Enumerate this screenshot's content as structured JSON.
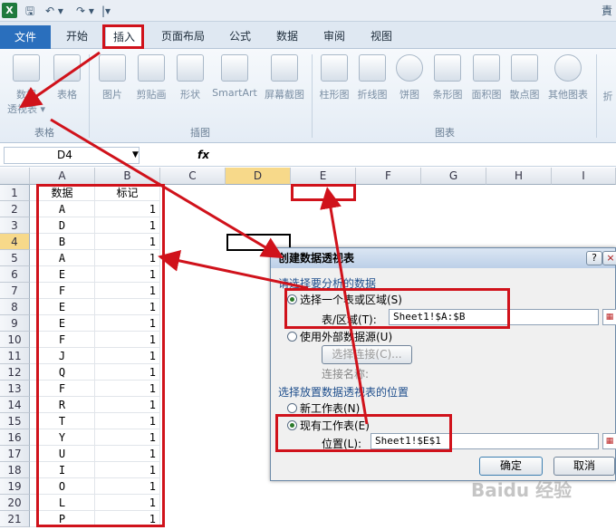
{
  "qat": {
    "logo": "X",
    "save": "🖫",
    "undo": "↶ ▾",
    "redo": "↷ ▾",
    "customize": "|▾",
    "right_edge": "責"
  },
  "tabs": [
    "文件",
    "开始",
    "插入",
    "页面布局",
    "公式",
    "数据",
    "审阅",
    "视图"
  ],
  "ribbon": {
    "table_group": {
      "pivot_line1": "数据",
      "pivot_line2": "透视表 ▾",
      "table": "表格",
      "label": "表格"
    },
    "illus_group": {
      "picture": "图片",
      "clipart": "剪贴画",
      "shapes": "形状",
      "smartart": "SmartArt",
      "screenshot": "屏幕截图",
      "label": "插图"
    },
    "chart_group": {
      "column": "柱形图",
      "line": "折线图",
      "pie": "饼图",
      "bar": "条形图",
      "area": "面积图",
      "scatter": "散点图",
      "other": "其他图表",
      "label": "图表"
    },
    "sparkline_partial": "折"
  },
  "formula_bar": {
    "name_box": "D4",
    "fx": "fx"
  },
  "columns": [
    "A",
    "B",
    "C",
    "D",
    "E",
    "F",
    "G",
    "H",
    "I"
  ],
  "rows": [
    "1",
    "2",
    "3",
    "4",
    "5",
    "6",
    "7",
    "8",
    "9",
    "10",
    "11",
    "12",
    "13",
    "14",
    "15",
    "16",
    "17",
    "18",
    "19",
    "20",
    "21"
  ],
  "sheet": {
    "header_a": "数据",
    "header_b": "标记",
    "col_a": [
      "A",
      "D",
      "B",
      "A",
      "E",
      "F",
      "E",
      "E",
      "F",
      "J",
      "Q",
      "F",
      "R",
      "T",
      "Y",
      "U",
      "I",
      "O",
      "L",
      "P"
    ],
    "col_b": [
      "1",
      "1",
      "1",
      "1",
      "1",
      "1",
      "1",
      "1",
      "1",
      "1",
      "1",
      "1",
      "1",
      "1",
      "1",
      "1",
      "1",
      "1",
      "1",
      "1"
    ]
  },
  "dialog": {
    "title": "创建数据透视表",
    "help": "?",
    "close": "×",
    "section1": "请选择要分析的数据",
    "opt_range": "选择一个表或区域(S)",
    "range_label": "表/区域(T):",
    "range_value": "Sheet1!$A:$B",
    "opt_external": "使用外部数据源(U)",
    "choose_conn": "选择连接(C)...",
    "conn_name": "连接名称:",
    "section2": "选择放置数据透视表的位置",
    "opt_new": "新工作表(N)",
    "opt_existing": "现有工作表(E)",
    "loc_label": "位置(L):",
    "loc_value": "Sheet1!$E$1",
    "ok": "确定",
    "cancel": "取消"
  },
  "watermark": "Baidu 经验",
  "colors": {
    "highlight": "#d0121b",
    "file_tab": "#2a6fbd",
    "cell_selected": "#000000"
  }
}
